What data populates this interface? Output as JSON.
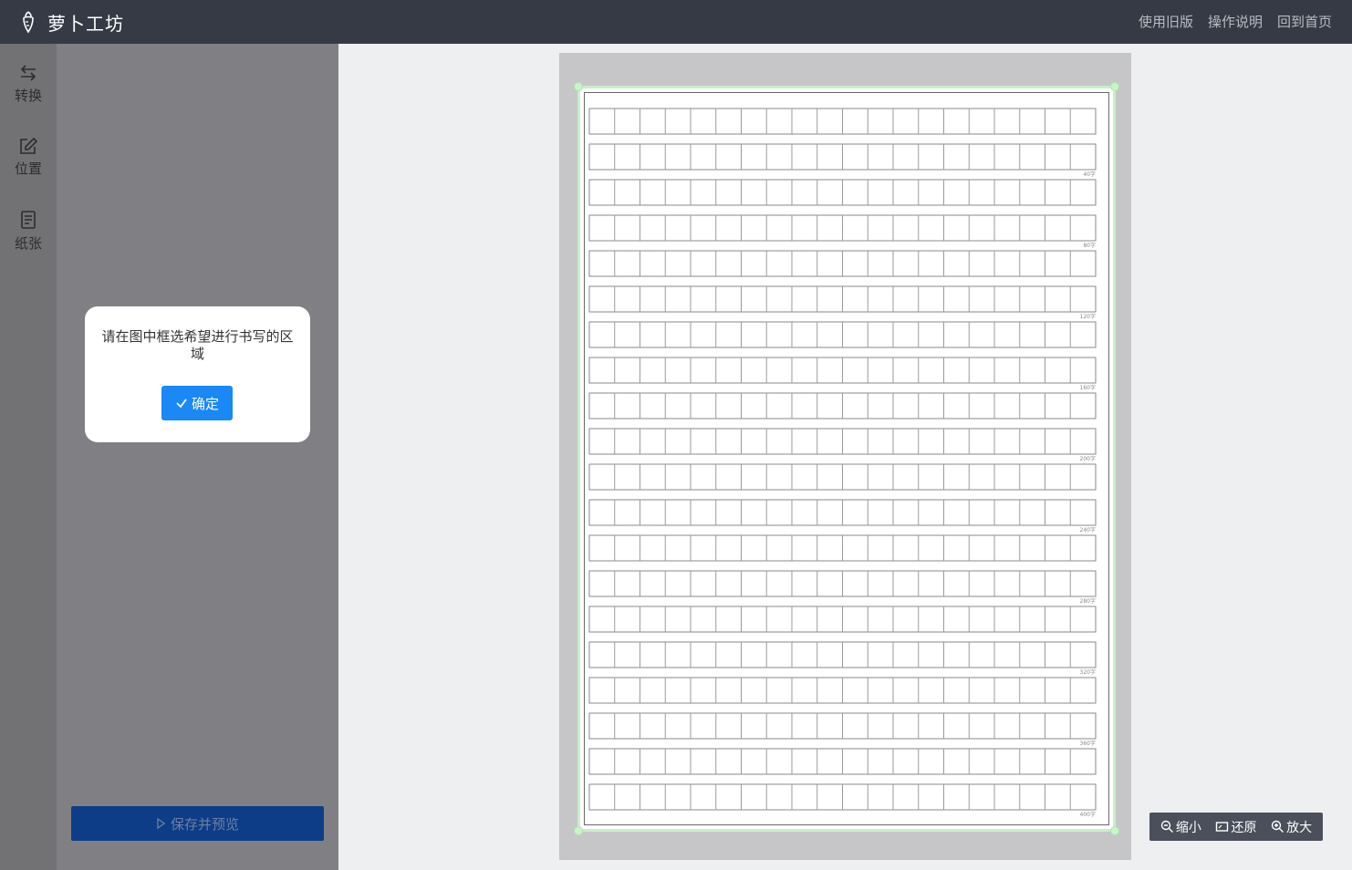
{
  "header": {
    "brand": "萝卜工坊",
    "nav": [
      "使用旧版",
      "操作说明",
      "回到首页"
    ]
  },
  "rail": {
    "items": [
      {
        "label": "转换",
        "icon": "swap-icon"
      },
      {
        "label": "位置",
        "icon": "edit-icon"
      },
      {
        "label": "纸张",
        "icon": "document-icon"
      }
    ]
  },
  "dialog": {
    "message": "请在图中框选希望进行书写的区域",
    "confirm_label": "确定"
  },
  "panel": {
    "save_label": "保存并预览"
  },
  "paper": {
    "rows": 20,
    "cols": 20,
    "count_labels": [
      "40字",
      "80字",
      "120字",
      "160字",
      "200字",
      "240字",
      "280字",
      "320字",
      "360字",
      "400字"
    ]
  },
  "zoom": {
    "zoom_out": "缩小",
    "reset": "还原",
    "zoom_in": "放大"
  },
  "colors": {
    "header_bg": "#353a45",
    "accent": "#1a88f5",
    "selection": "#c8f0c8"
  }
}
